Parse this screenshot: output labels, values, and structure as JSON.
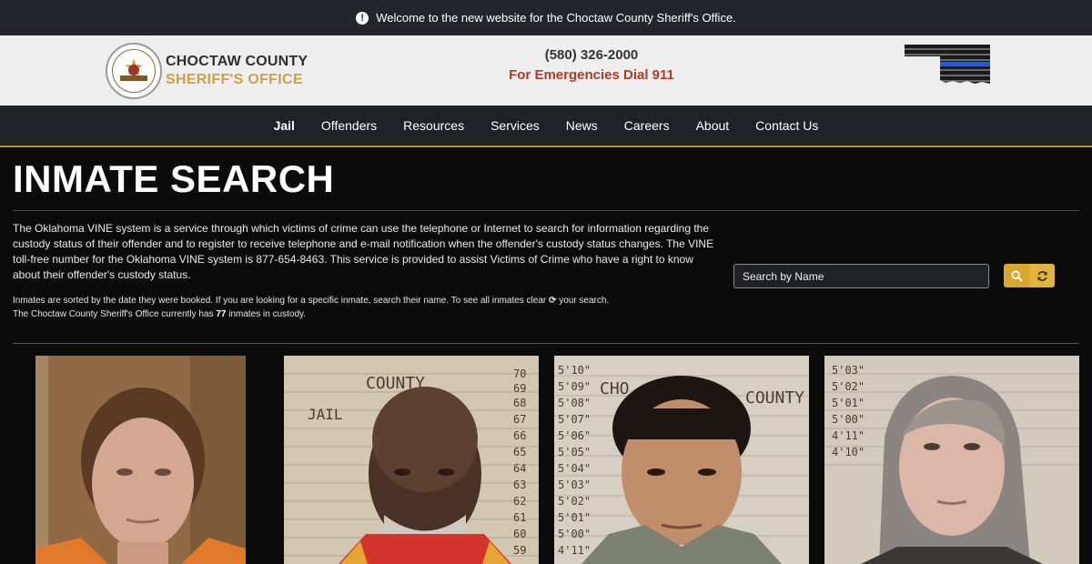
{
  "alert": {
    "message": "Welcome to the new website for the Choctaw County Sheriff's Office.",
    "icon": "exclamation-circle-icon"
  },
  "header": {
    "logo": {
      "line1": "CHOCTAW COUNTY",
      "line2": "SHERIFF'S OFFICE"
    },
    "phone": "(580) 326-2000",
    "emergency": "For Emergencies Dial 911"
  },
  "nav": {
    "items": [
      "Jail",
      "Offenders",
      "Resources",
      "Services",
      "News",
      "Careers",
      "About",
      "Contact Us"
    ],
    "active": "Jail"
  },
  "page": {
    "title": "INMATE SEARCH",
    "vine_text": "The Oklahoma VINE system is a service through which victims of crime can use the telephone or Internet to search for information regarding the custody status of their offender and to register to receive telephone and e-mail notification when the offender's custody status changes. The VINE toll-free number for the Oklahoma VINE system is 877-654-8463. This service is provided to assist Victims of Crime who have a right to know about their offender's custody status.",
    "note_sorted_before": "Inmates are sorted by the date they were booked. If you are looking for a specific inmate, search their name. To see all inmates clear",
    "note_sorted_after": "your search.",
    "note_count_before": "The Choctaw County Sheriff's Office currently has",
    "inmate_count": "77",
    "note_count_after": "inmates in custody."
  },
  "search": {
    "placeholder": "Search by Name",
    "value": ""
  },
  "colors": {
    "accent": "#d9a72b",
    "topbar": "#22262b",
    "nav": "#1f2327",
    "emergency": "#b13a27",
    "background": "#0b0b0b"
  },
  "photos": [
    {
      "board_text": []
    },
    {
      "board_text": [
        "COUNTY",
        "JAIL",
        "70",
        "69",
        "68",
        "67",
        "66",
        "65",
        "64",
        "63",
        "62",
        "61",
        "60",
        "59"
      ]
    },
    {
      "board_text": [
        "CHO",
        "COUNTY",
        "5'10\"",
        "5'09\"",
        "5'08\"",
        "5'07\"",
        "5'06\"",
        "5'05\"",
        "5'04\"",
        "5'03\"",
        "5'02\"",
        "5'01\"",
        "5'00\"",
        "4'11\""
      ]
    },
    {
      "board_text": [
        "5'03\"",
        "5'02\"",
        "5'01\"",
        "5'00\"",
        "4'11\"",
        "4'10\""
      ]
    }
  ]
}
